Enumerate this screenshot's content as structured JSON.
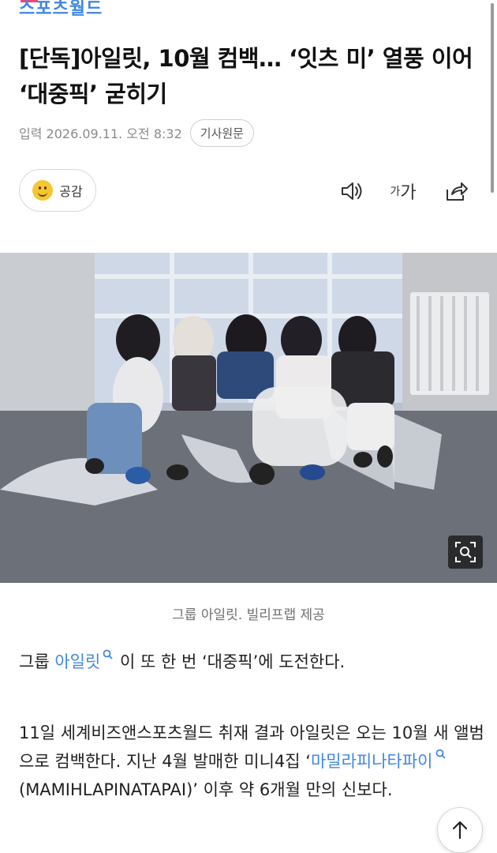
{
  "brand": {
    "logo_text": "스포츠월드",
    "accent": "#3f87e3"
  },
  "article": {
    "headline": "[단독]아일릿, 10월 컴백… ‘잇츠 미’ 열풍 이어 ‘대중픽’ 굳히기",
    "published_label": "입력 2026.09.11. 오전 8:32",
    "source_button": "기사원문"
  },
  "toolbar": {
    "empathy_label": "공감",
    "font_small": "가",
    "font_large": "가"
  },
  "photo": {
    "caption": "그룹 아일릿. 빌리프랩 제공"
  },
  "body": {
    "p1_prefix": "그룹 ",
    "p1_link": "아일릿",
    "p1_suffix": " 이 또 한 번 ‘대중픽’에 도전한다.",
    "p2_part1": "11일 세계비즈앤스포츠월드 취재 결과 아일릿은 오는 10월 새 앨범으로 컴백한다. 지난 4월 발매한 미니4집 ‘",
    "p2_link": "마밀라피나타파이",
    "p2_part2": " (MAMIHLAPINATAPAI)’ 이후 약 6개월 만의 신보다."
  },
  "colors": {
    "link": "#3f87e3",
    "logo_accent_bar": "#e8467c"
  }
}
